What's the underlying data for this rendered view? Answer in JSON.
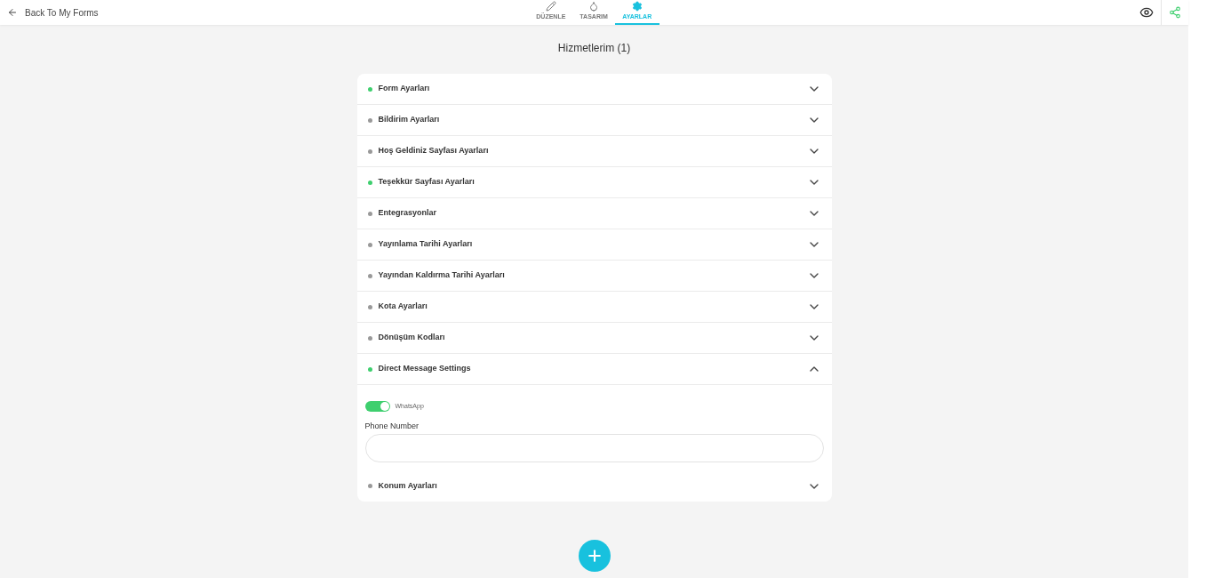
{
  "header": {
    "back_link": "Back To My Forms",
    "tabs": [
      {
        "label": "DÜZENLE",
        "selected": false
      },
      {
        "label": "TASARIM",
        "selected": false
      },
      {
        "label": "AYARLAR",
        "selected": true
      }
    ]
  },
  "form_title": "Hizmetlerim (1)",
  "sections": [
    {
      "title": "Form Ayarları",
      "active": true,
      "expanded": false
    },
    {
      "title": "Bildirim Ayarları",
      "active": false,
      "expanded": false
    },
    {
      "title": "Hoş Geldiniz Sayfası Ayarları",
      "active": false,
      "expanded": false
    },
    {
      "title": "Teşekkür Sayfası Ayarları",
      "active": true,
      "expanded": false
    },
    {
      "title": "Entegrasyonlar",
      "active": false,
      "expanded": false
    },
    {
      "title": "Yayınlama Tarihi Ayarları",
      "active": false,
      "expanded": false
    },
    {
      "title": "Yayından Kaldırma Tarihi Ayarları",
      "active": false,
      "expanded": false
    },
    {
      "title": "Kota Ayarları",
      "active": false,
      "expanded": false
    },
    {
      "title": "Dönüşüm Kodları",
      "active": false,
      "expanded": false
    },
    {
      "title": "Direct Message Settings",
      "active": true,
      "expanded": true,
      "content": {
        "toggle": {
          "label": "WhatsApp",
          "on": true
        },
        "field_label": "Phone Number"
      }
    },
    {
      "title": "Konum Ayarları",
      "active": false,
      "expanded": false
    }
  ]
}
